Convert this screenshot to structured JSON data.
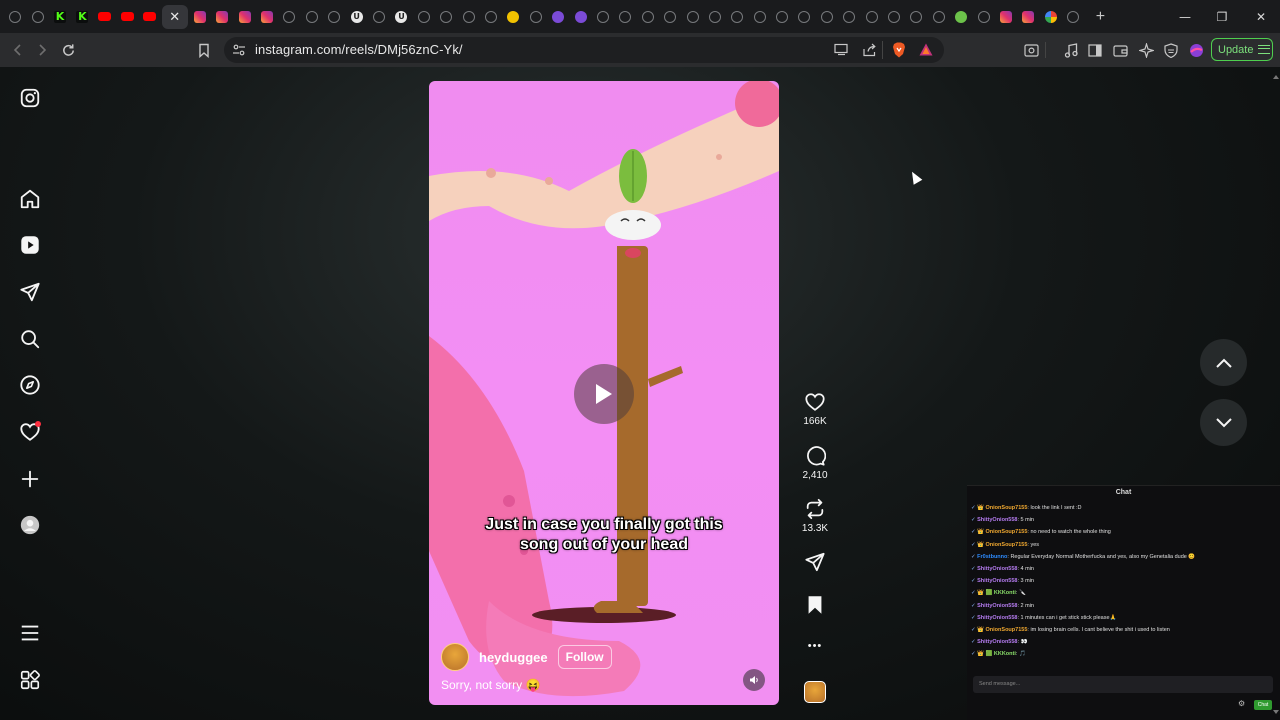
{
  "browser": {
    "tabs": [
      {
        "icon": "ring"
      },
      {
        "icon": "ring"
      },
      {
        "icon": "kick",
        "glyph": "K"
      },
      {
        "icon": "kick",
        "glyph": "K"
      },
      {
        "icon": "yt"
      },
      {
        "icon": "yt"
      },
      {
        "icon": "yt"
      },
      {
        "icon": "close",
        "active": true
      },
      {
        "icon": "ig"
      },
      {
        "icon": "ig"
      },
      {
        "icon": "ig"
      },
      {
        "icon": "ig"
      },
      {
        "icon": "ring"
      },
      {
        "icon": "ring"
      },
      {
        "icon": "ring"
      },
      {
        "icon": "wht",
        "glyph": "U"
      },
      {
        "icon": "ring"
      },
      {
        "icon": "wht",
        "glyph": "U"
      },
      {
        "icon": "ring"
      },
      {
        "icon": "ring"
      },
      {
        "icon": "ring"
      },
      {
        "icon": "ring"
      },
      {
        "icon": "yel"
      },
      {
        "icon": "ring"
      },
      {
        "icon": "pur"
      },
      {
        "icon": "pur"
      },
      {
        "icon": "ring"
      },
      {
        "icon": "x"
      },
      {
        "icon": "x"
      },
      {
        "icon": "x"
      },
      {
        "icon": "x"
      },
      {
        "icon": "x"
      },
      {
        "icon": "x"
      },
      {
        "icon": "x"
      },
      {
        "icon": "x"
      },
      {
        "icon": "x"
      },
      {
        "icon": "ring"
      },
      {
        "icon": "ring"
      },
      {
        "icon": "ring"
      },
      {
        "icon": "ring"
      },
      {
        "icon": "ring"
      },
      {
        "icon": "ring"
      },
      {
        "icon": "grn"
      },
      {
        "icon": "x"
      },
      {
        "icon": "ig"
      },
      {
        "icon": "ig"
      },
      {
        "icon": "g"
      },
      {
        "icon": "ring"
      }
    ],
    "new_tab_glyph": "+",
    "window_controls": {
      "minimize": "—",
      "maximize": "❐",
      "close": "✕"
    },
    "address": "instagram.com/reels/DMj56znC-Yk/",
    "update_label": "Update"
  },
  "reel": {
    "caption_line1": "Just in case you finally got this",
    "caption_line2": "song out of your head",
    "author": "heyduggee",
    "follow_label": "Follow",
    "description": "Sorry, not sorry 😝",
    "likes": "166K",
    "comments": "2,410",
    "reposts": "13.3K",
    "more_glyph": "•••"
  },
  "chat": {
    "title": "Chat",
    "input_placeholder": "Send message...",
    "send_label": "Chat",
    "messages": [
      {
        "badges": "✓ 👑",
        "user": "OnionSoup7155",
        "cls": "u1",
        "text": ": look the link I sent :D"
      },
      {
        "badges": "✓",
        "user": "ShittyOnion558",
        "cls": "u2",
        "text": ": 5 min"
      },
      {
        "badges": "✓ 👑",
        "user": "OnionSoup7155",
        "cls": "u1",
        "text": ": no need to watch the whole thing"
      },
      {
        "badges": "✓ 👑",
        "user": "OnionSoup7155",
        "cls": "u1",
        "text": ": yes"
      },
      {
        "badges": "✓",
        "user": "Fr0stbunno",
        "cls": "u3",
        "text": ": Regular Everyday Normal Motherfucka and yes, also my Genetalia dude 😊"
      },
      {
        "badges": "✓",
        "user": "ShittyOnion558",
        "cls": "u2",
        "text": ": 4 min"
      },
      {
        "badges": "✓",
        "user": "ShittyOnion558",
        "cls": "u2",
        "text": ": 3 min"
      },
      {
        "badges": "✓ 👑 🟩",
        "user": "KKKonti",
        "cls": "u4",
        "text": ": 🔪"
      },
      {
        "badges": "✓",
        "user": "ShittyOnion558",
        "cls": "u2",
        "text": ": 2 min"
      },
      {
        "badges": "✓",
        "user": "ShittyOnion558",
        "cls": "u2",
        "text": ": 1 minutes can i get stick stick please🙏"
      },
      {
        "badges": "✓ 👑",
        "user": "OnionSoup7155",
        "cls": "u1",
        "text": ": im losing brain cells. I cant believe the shit i used to listen"
      },
      {
        "badges": "✓",
        "user": "ShittyOnion558",
        "cls": "u2",
        "text": ": 👀"
      },
      {
        "badges": "✓ 👑 🟩",
        "user": "KKKonti",
        "cls": "u4",
        "text": ": 🎵"
      }
    ]
  }
}
